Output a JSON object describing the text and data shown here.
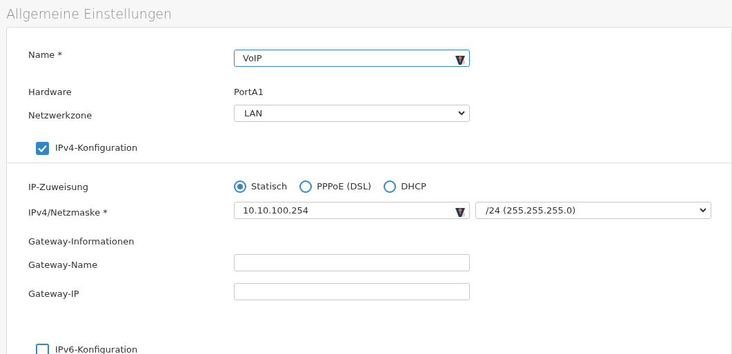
{
  "title": "Allgemeine Einstellungen",
  "rows": [
    {
      "kind": "input",
      "label": "Name *",
      "value": "VoIP",
      "focused": true,
      "badge": "3"
    },
    {
      "kind": "text",
      "label": "Hardware",
      "value": "PortA1"
    },
    {
      "kind": "select",
      "label": "Netzwerkzone",
      "value": "LAN"
    },
    {
      "kind": "checkbox",
      "label": "IPv4-Konfiguration",
      "checked": true
    },
    {
      "kind": "divider"
    },
    {
      "kind": "radio",
      "label": "IP-Zuweisung",
      "options": [
        {
          "label": "Statisch",
          "selected": true
        },
        {
          "label": "PPPoE (DSL)",
          "selected": false
        },
        {
          "label": "DHCP",
          "selected": false
        }
      ]
    },
    {
      "kind": "inputselect",
      "label": "IPv4/Netzmaske *",
      "value": "10.10.100.254",
      "badge": "3",
      "select": "/24 (255.255.255.0)"
    },
    {
      "kind": "heading",
      "label": "Gateway-Informationen"
    },
    {
      "kind": "input",
      "label": "Gateway-Name",
      "value": ""
    },
    {
      "kind": "input",
      "label": "Gateway-IP",
      "value": ""
    },
    {
      "kind": "spacer"
    },
    {
      "kind": "checkbox",
      "label": "IPv6-Konfiguration",
      "checked": false
    }
  ]
}
